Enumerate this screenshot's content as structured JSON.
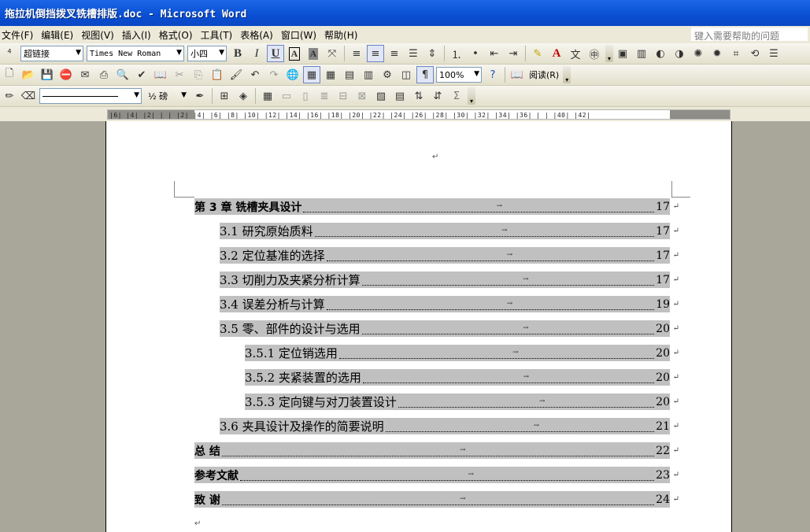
{
  "window": {
    "title": "拖拉机倒挡拨叉铣槽排版.doc - Microsoft Word"
  },
  "menu": {
    "items": [
      "文件(F)",
      "编辑(E)",
      "视图(V)",
      "插入(I)",
      "格式(O)",
      "工具(T)",
      "表格(A)",
      "窗口(W)",
      "帮助(H)"
    ],
    "help_placeholder": "键入需要帮助的问题"
  },
  "format_toolbar": {
    "style": "超链接",
    "font": "Times New Roman",
    "size": "小四"
  },
  "standard_toolbar": {
    "zoom": "100%",
    "read_label": "阅读(R)"
  },
  "drawing_toolbar": {
    "line_weight": "½ 磅"
  },
  "ruler": {
    "text": "|6| |4| |2| |  | |2| |4| |6| |8| |10| |12| |14| |16| |18| |20| |22| |24| |26| |28| |30| |32| |34| |36| |  | |40| |42|"
  },
  "document": {
    "top_para_mark": "↵",
    "end_para_mark": "↵",
    "toc": [
      {
        "title": "第 3 章  铣槽夹具设计",
        "page": "17",
        "level": 1
      },
      {
        "title": "3.1 研究原始质料",
        "page": "17",
        "level": 2
      },
      {
        "title": "3.2 定位基准的选择",
        "page": "17",
        "level": 2
      },
      {
        "title": "3.3  切削力及夹紧分析计算",
        "page": "17",
        "level": 2
      },
      {
        "title": "3.4  误差分析与计算",
        "page": "19",
        "level": 2
      },
      {
        "title": "3.5  零、部件的设计与选用",
        "page": "20",
        "level": 2
      },
      {
        "title": "3.5.1 定位销选用",
        "page": "20",
        "level": 3
      },
      {
        "title": "3.5.2 夹紧装置的选用",
        "page": "20",
        "level": 3
      },
      {
        "title": "3.5.3  定向键与对刀装置设计",
        "page": "20",
        "level": 3
      },
      {
        "title": "3.6  夹具设计及操作的简要说明",
        "page": "21",
        "level": 2
      },
      {
        "title": "总  结",
        "page": "22",
        "level": 1
      },
      {
        "title": "参考文献",
        "page": "23",
        "level": 1
      },
      {
        "title": "致  谢",
        "page": "24",
        "level": 1
      }
    ]
  }
}
